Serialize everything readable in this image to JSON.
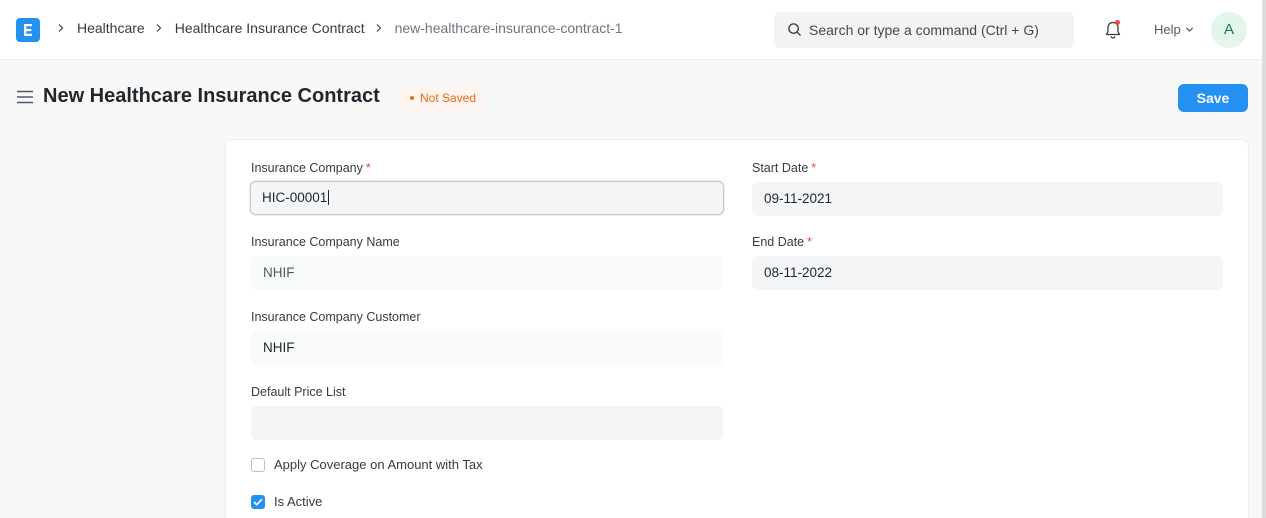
{
  "navbar": {
    "logo_letter": "E",
    "breadcrumbs": [
      "Healthcare",
      "Healthcare Insurance Contract",
      "new-healthcare-insurance-contract-1"
    ],
    "search_placeholder": "Search or type a command (Ctrl + G)",
    "help_label": "Help",
    "avatar_initial": "A"
  },
  "page": {
    "title": "New Healthcare Insurance Contract",
    "status": "Not Saved",
    "save_label": "Save"
  },
  "form": {
    "insurance_company": {
      "label": "Insurance Company",
      "required": "*",
      "value": "HIC-00001"
    },
    "insurance_company_name": {
      "label": "Insurance Company Name",
      "value": "NHIF"
    },
    "insurance_company_customer": {
      "label": "Insurance Company Customer",
      "value": "NHIF"
    },
    "default_price_list": {
      "label": "Default Price List",
      "value": ""
    },
    "apply_coverage": {
      "label": "Apply Coverage on Amount with Tax",
      "checked": false
    },
    "is_active": {
      "label": "Is Active",
      "checked": true
    },
    "start_date": {
      "label": "Start Date",
      "required": "*",
      "value": "09-11-2021"
    },
    "end_date": {
      "label": "End Date",
      "required": "*",
      "value": "08-11-2022"
    }
  },
  "colors": {
    "primary": "#2490ef",
    "status": "#e86c13",
    "required": "#e24c4c"
  }
}
